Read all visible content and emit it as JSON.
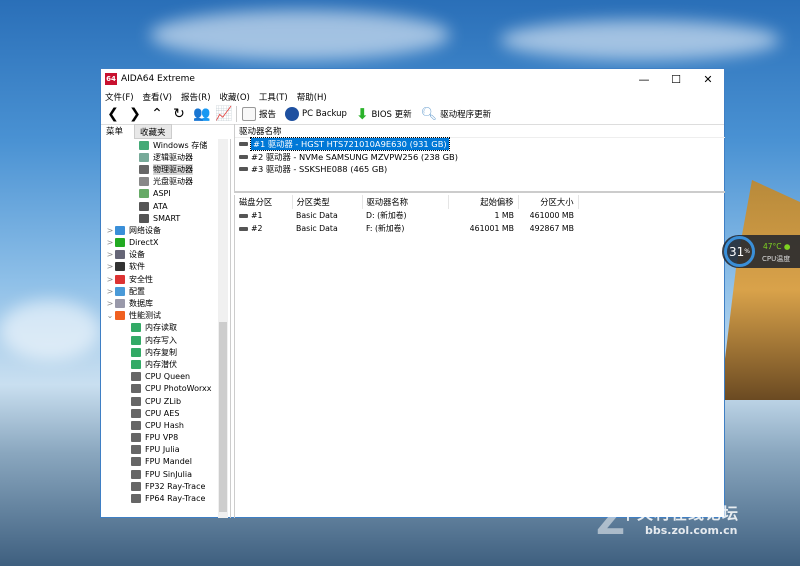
{
  "window": {
    "title": "AIDA64 Extreme",
    "logo": "64",
    "min": "—",
    "max": "☐",
    "close": "✕"
  },
  "menu": [
    "文件(F)",
    "查看(V)",
    "报告(R)",
    "收藏(O)",
    "工具(T)",
    "帮助(H)"
  ],
  "toolbar": {
    "nav": [
      "❮",
      "❯",
      "⌃",
      "↻",
      "👥",
      "📈"
    ],
    "report": "报告",
    "pc_backup": "PC Backup",
    "bios": "BIOS 更新",
    "driver": "驱动程序更新"
  },
  "tabs": {
    "menu": "菜单",
    "favorites": "收藏夹"
  },
  "tree": [
    {
      "label": "Windows 存储",
      "level": 2,
      "color": "#4a7"
    },
    {
      "label": "逻辑驱动器",
      "level": 2,
      "color": "#7a9"
    },
    {
      "label": "物理驱动器",
      "level": 2,
      "color": "#666",
      "selected": true
    },
    {
      "label": "光盘驱动器",
      "level": 2,
      "color": "#888"
    },
    {
      "label": "ASPI",
      "level": 2,
      "color": "#6a6"
    },
    {
      "label": "ATA",
      "level": 2,
      "color": "#555"
    },
    {
      "label": "SMART",
      "level": 2,
      "color": "#555"
    },
    {
      "label": "网络设备",
      "level": 1,
      "arrow": ">",
      "color": "#3a8fd8"
    },
    {
      "label": "DirectX",
      "level": 1,
      "arrow": ">",
      "color": "#2a2"
    },
    {
      "label": "设备",
      "level": 1,
      "arrow": ">",
      "color": "#667"
    },
    {
      "label": "软件",
      "level": 1,
      "arrow": ">",
      "color": "#333"
    },
    {
      "label": "安全性",
      "level": 1,
      "arrow": ">",
      "color": "#d33"
    },
    {
      "label": "配置",
      "level": 1,
      "arrow": ">",
      "color": "#4a9ad8"
    },
    {
      "label": "数据库",
      "level": 1,
      "arrow": ">",
      "color": "#99a"
    },
    {
      "label": "性能测试",
      "level": 1,
      "arrow": "⌄",
      "color": "#f06020"
    },
    {
      "label": "内存读取",
      "level": 2,
      "color": "#3a6"
    },
    {
      "label": "内存写入",
      "level": 2,
      "color": "#3a6"
    },
    {
      "label": "内存复制",
      "level": 2,
      "color": "#3a6"
    },
    {
      "label": "内存潜伏",
      "level": 2,
      "color": "#3a6"
    },
    {
      "label": "CPU Queen",
      "level": 2,
      "color": "#666"
    },
    {
      "label": "CPU PhotoWorxx",
      "level": 2,
      "color": "#666"
    },
    {
      "label": "CPU ZLib",
      "level": 2,
      "color": "#666"
    },
    {
      "label": "CPU AES",
      "level": 2,
      "color": "#666"
    },
    {
      "label": "CPU Hash",
      "level": 2,
      "color": "#666"
    },
    {
      "label": "FPU VP8",
      "level": 2,
      "color": "#666"
    },
    {
      "label": "FPU Julia",
      "level": 2,
      "color": "#666"
    },
    {
      "label": "FPU Mandel",
      "level": 2,
      "color": "#666"
    },
    {
      "label": "FPU SinJulia",
      "level": 2,
      "color": "#666"
    },
    {
      "label": "FP32 Ray-Trace",
      "level": 2,
      "color": "#666"
    },
    {
      "label": "FP64 Ray-Trace",
      "level": 2,
      "color": "#666"
    }
  ],
  "drives": {
    "header": "驱动器名称",
    "items": [
      "#1 驱动器 - HGST HTS721010A9E630 (931 GB)",
      "#2 驱动器 - NVMe    SAMSUNG MZVPW256 (238 GB)",
      "#3 驱动器 - SSKSHE088 (465 GB)"
    ]
  },
  "partitions": {
    "headers": [
      "磁盘分区",
      "分区类型",
      "驱动器名称",
      "起始偏移",
      "分区大小"
    ],
    "rows": [
      [
        "#1",
        "Basic Data",
        "D: (新加卷)",
        "1 MB",
        "461000 MB"
      ],
      [
        "#2",
        "Basic Data",
        "F: (新加卷)",
        "461001 MB",
        "492867 MB"
      ]
    ]
  },
  "widget": {
    "percent": "31",
    "unit": "%",
    "temp": "47°C",
    "label": "CPU温度"
  },
  "watermark": {
    "title": "中关村在线论坛",
    "url": "bbs.zol.com.cn"
  }
}
